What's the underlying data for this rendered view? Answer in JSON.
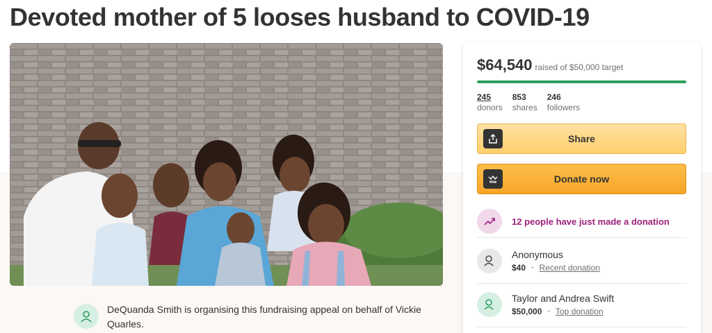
{
  "campaign": {
    "title": "Devoted mother of 5 looses husband to COVID-19"
  },
  "hero": {
    "icon": "family-photo"
  },
  "organiser": {
    "text": "DeQuanda Smith is organising this fundraising appeal on behalf of Vickie Quarles.",
    "icon": "person-icon"
  },
  "donation_card": {
    "raised_amount": "$64,540",
    "raised_target": "raised of $50,000 target",
    "progress_fraction": 1.0,
    "progress_color": "#2a9d5c",
    "stats": [
      {
        "number": "245",
        "label": "donors"
      },
      {
        "number": "853",
        "label": "shares"
      },
      {
        "number": "246",
        "label": "followers"
      }
    ],
    "share_label": "Share",
    "donate_label": "Donate now",
    "recent_notice": "12 people have just made a donation",
    "donations": [
      {
        "name": "Anonymous",
        "amount": "$40",
        "tag": "Recent donation"
      },
      {
        "name": "Taylor and Andrea Swift",
        "amount": "$50,000",
        "tag": "Top donation"
      }
    ]
  },
  "colors": {
    "share_button": "#ffcf6b",
    "donate_button": "#f7a529",
    "recent_text": "#9c1f7a"
  }
}
